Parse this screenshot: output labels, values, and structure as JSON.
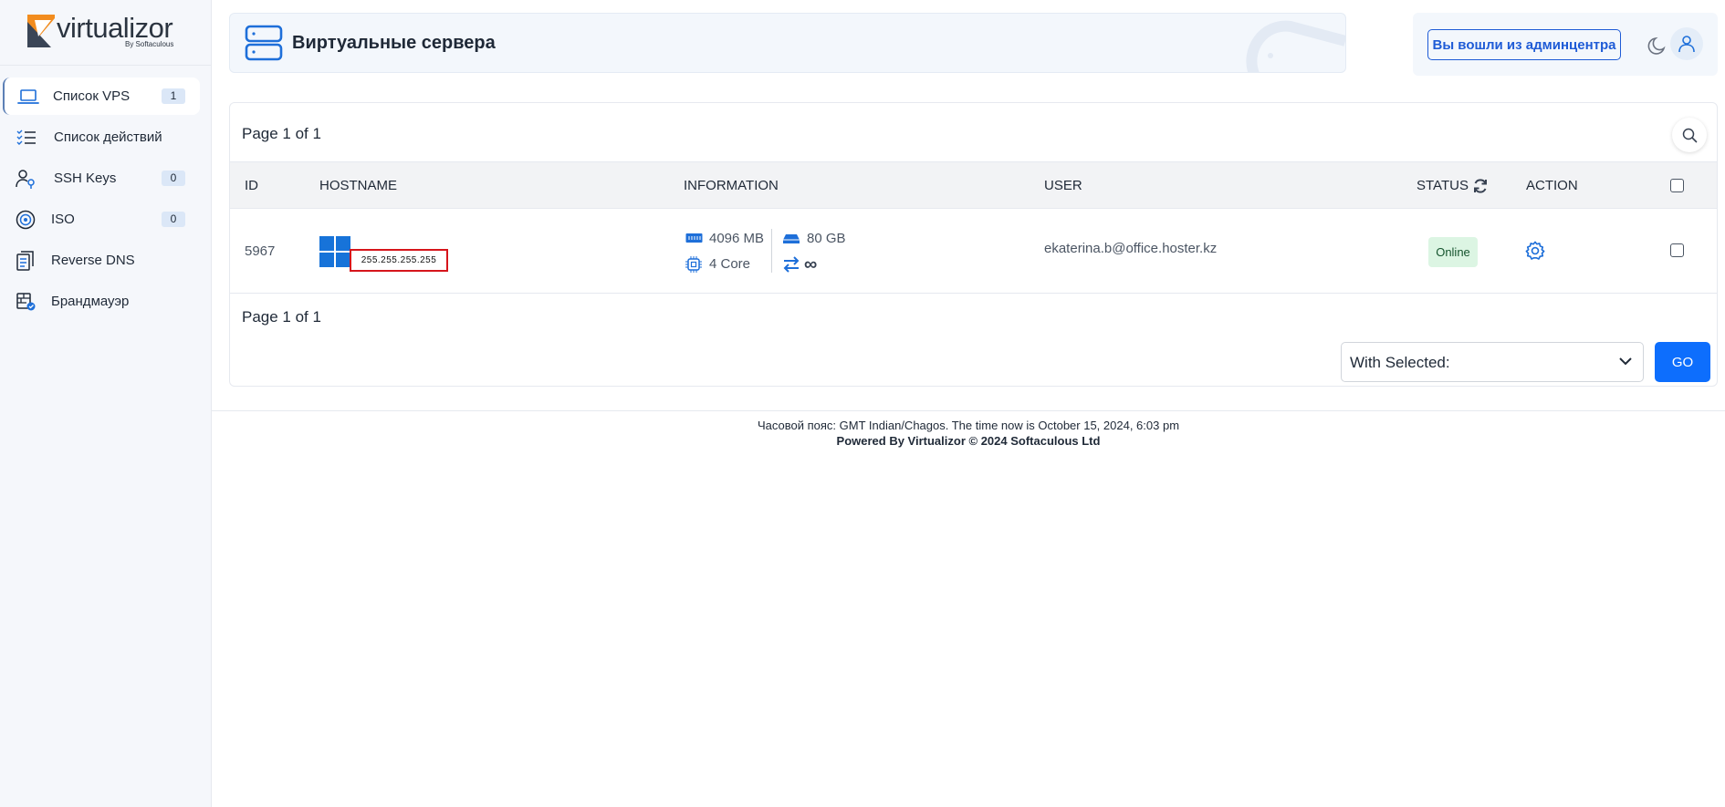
{
  "brand": {
    "name": "virtualizor",
    "sub": "By Softaculous",
    "colors": {
      "orange": "#f28c1e",
      "navy": "#2b3440"
    }
  },
  "sidebar": {
    "items": [
      {
        "label": "Список VPS",
        "badge": "1",
        "icon": "laptop-icon",
        "active": true
      },
      {
        "label": "Список действий",
        "badge": "",
        "icon": "checklist-icon",
        "active": false
      },
      {
        "label": "SSH Keys",
        "badge": "0",
        "icon": "user-key-icon",
        "active": false
      },
      {
        "label": "ISO",
        "badge": "0",
        "icon": "disc-icon",
        "active": false
      },
      {
        "label": "Reverse DNS",
        "badge": "",
        "icon": "copy-icon",
        "active": false
      },
      {
        "label": "Брандмауэр",
        "badge": "",
        "icon": "firewall-icon",
        "active": false
      }
    ]
  },
  "header": {
    "title": "Виртуальные сервера",
    "admin_button": "Вы вошли из админцентра"
  },
  "table": {
    "page_info_top": "Page 1 of 1",
    "page_info_bottom": "Page 1 of 1",
    "columns": {
      "id": "ID",
      "hostname": "HOSTNAME",
      "information": "INFORMATION",
      "user": "USER",
      "status": "STATUS",
      "action": "ACTION"
    },
    "rows": [
      {
        "id": "5967",
        "hostname": "255.255.255.255",
        "os": "windows-icon",
        "ram": "4096 MB",
        "disk": "80 GB",
        "cpu": "4 Core",
        "bandwidth": "∞",
        "user": "ekaterina.b@office.hoster.kz",
        "status": "Online"
      }
    ],
    "with_selected": "With Selected:",
    "go_button": "GO"
  },
  "footer": {
    "timezone": "Часовой пояс: GMT Indian/Chagos. The time now is October 15, 2024, 6:03 pm",
    "powered": "Powered By Virtualizor © 2024 Softaculous Ltd"
  },
  "colors": {
    "accent": "#0d6efd",
    "icon_blue": "#1e6fd9",
    "status_bg": "#dcf5e3",
    "highlight_red": "#d6151b"
  }
}
